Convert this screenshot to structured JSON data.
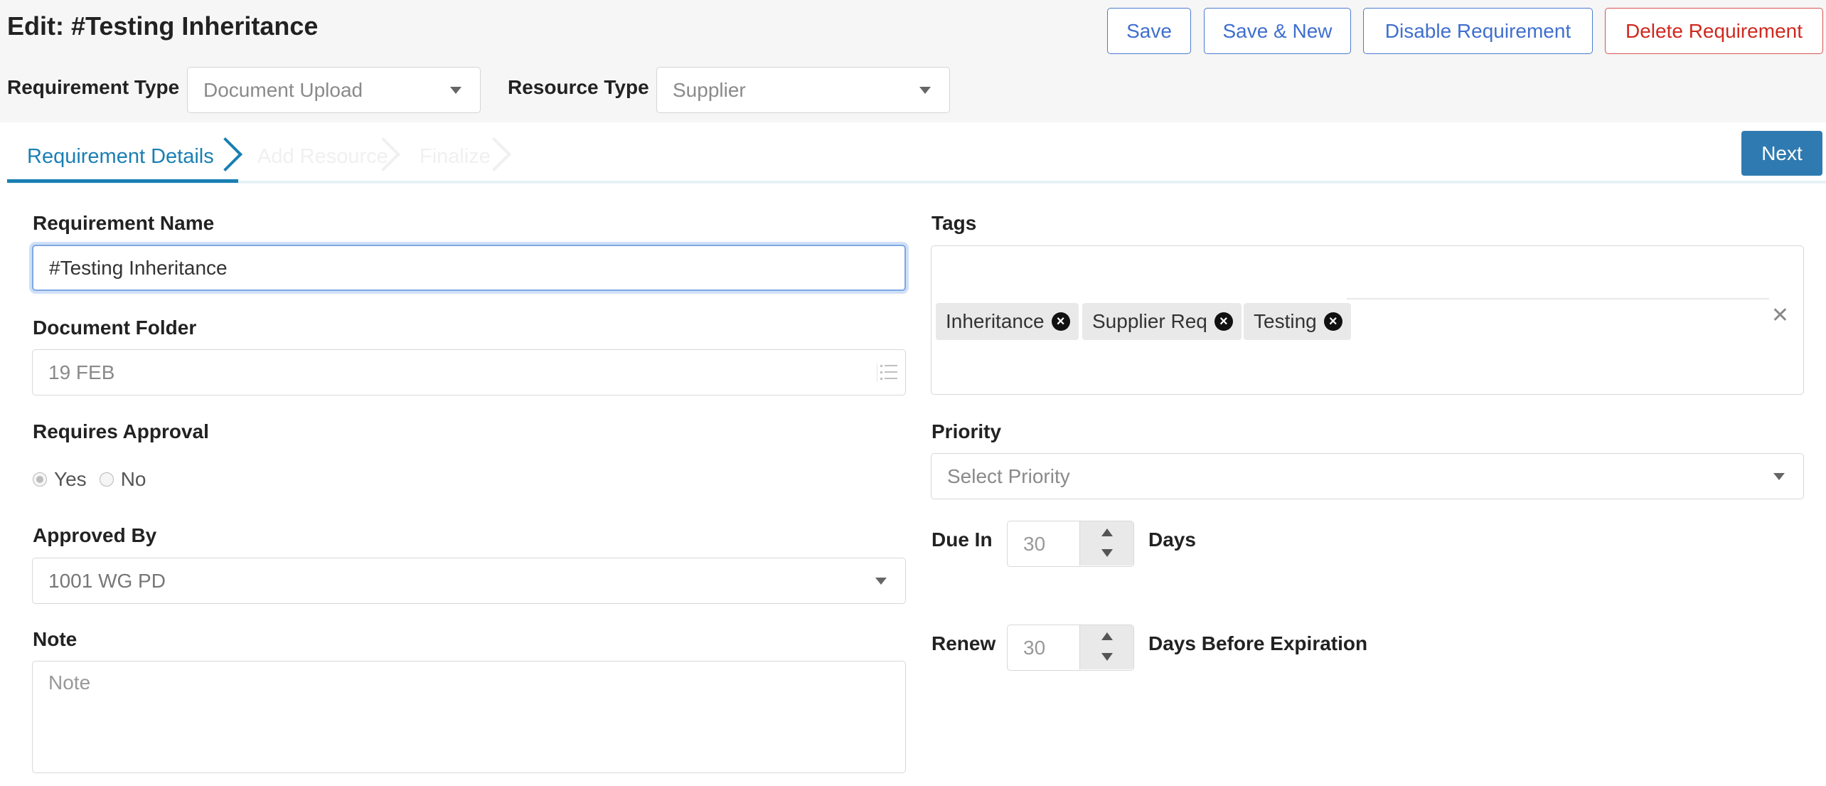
{
  "header": {
    "title": "Edit: #Testing Inheritance",
    "buttons": {
      "save": "Save",
      "save_new": "Save & New",
      "disable": "Disable Requirement",
      "delete": "Delete Requirement"
    },
    "requirement_type": {
      "label": "Requirement Type",
      "value": "Document Upload"
    },
    "resource_type": {
      "label": "Resource Type",
      "value": "Supplier"
    }
  },
  "wizard": {
    "steps": [
      "Requirement Details",
      "Add Resource",
      "Finalize"
    ],
    "active_step": 0,
    "next_label": "Next"
  },
  "form": {
    "requirement_name": {
      "label": "Requirement Name",
      "value": "#Testing Inheritance"
    },
    "document_folder": {
      "label": "Document Folder",
      "value": "19 FEB"
    },
    "requires_approval": {
      "label": "Requires Approval",
      "options": [
        "Yes",
        "No"
      ],
      "selected": "Yes"
    },
    "approved_by": {
      "label": "Approved By",
      "value": "1001 WG PD"
    },
    "note": {
      "label": "Note",
      "placeholder": "Note",
      "value": ""
    },
    "tags": {
      "label": "Tags",
      "items": [
        "Inheritance",
        "Supplier Req",
        "Testing"
      ]
    },
    "priority": {
      "label": "Priority",
      "placeholder": "Select Priority"
    },
    "due_in": {
      "label": "Due In",
      "value": "30",
      "suffix": "Days"
    },
    "renew": {
      "label": "Renew",
      "value": "30",
      "suffix": "Days Before Expiration"
    }
  },
  "colors": {
    "accent": "#1a7fb3",
    "button_outline": "#4a7bd0",
    "danger": "#d0281f",
    "next_button": "#2f7ab0"
  },
  "icons": {
    "tag_remove": "circle-x-icon",
    "clear_all": "close-icon",
    "dropdown": "caret-down-icon",
    "folder_list": "list-icon"
  }
}
